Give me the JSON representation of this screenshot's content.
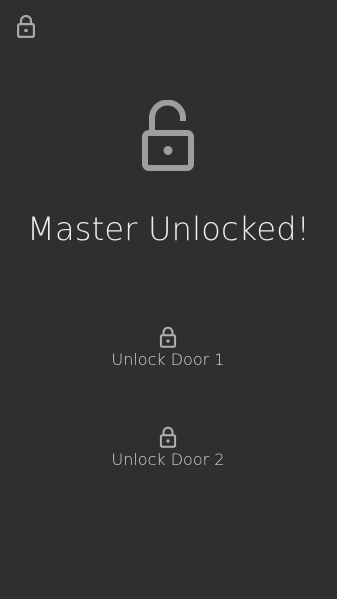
{
  "header": {
    "icon": "lock-closed-icon"
  },
  "hero": {
    "icon": "lock-open-icon",
    "title": "Master Unlocked!"
  },
  "doors": [
    {
      "label": "Unlock Door 1",
      "icon": "lock-closed-icon"
    },
    {
      "label": "Unlock Door 2",
      "icon": "lock-closed-icon"
    }
  ],
  "colors": {
    "background": "#2f2f2f",
    "icon": "#9e9e9e",
    "text": "#efefef"
  }
}
